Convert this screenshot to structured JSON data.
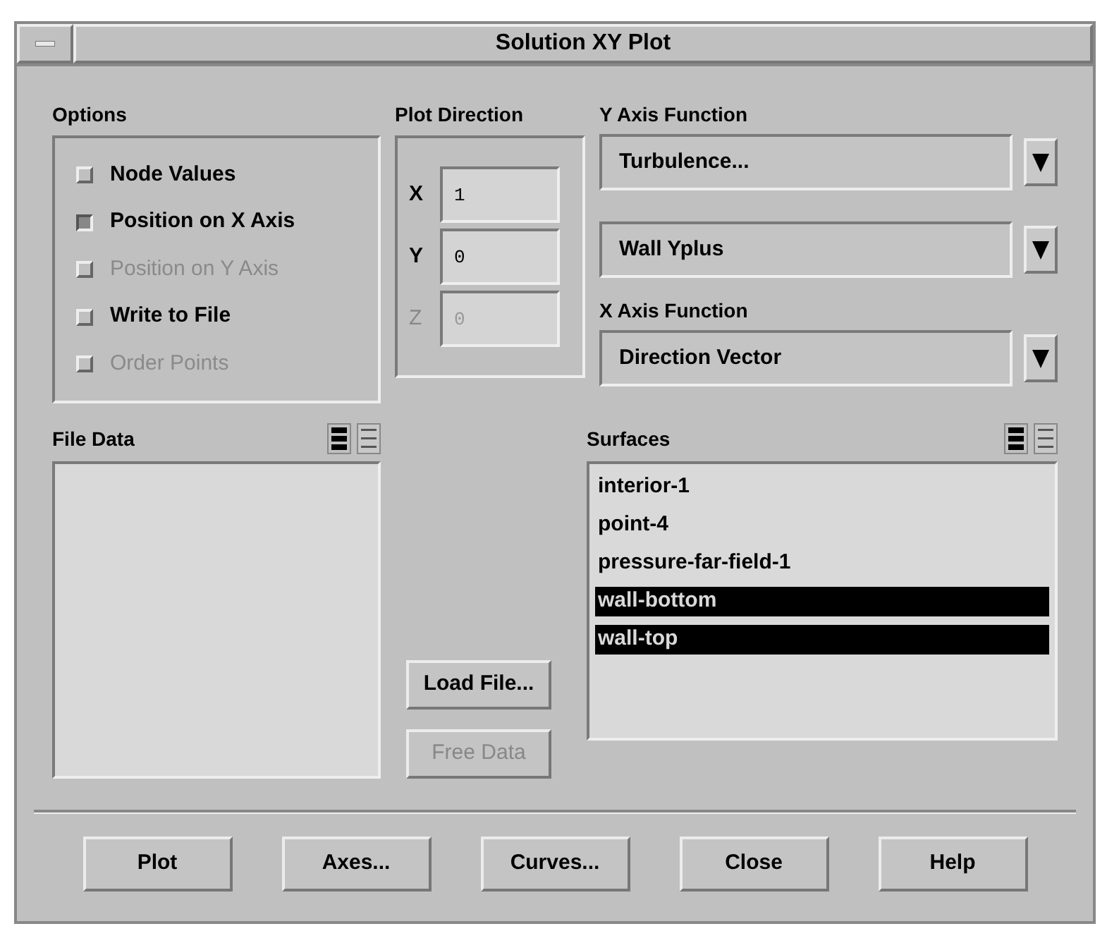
{
  "window": {
    "title": "Solution XY Plot"
  },
  "options": {
    "label": "Options",
    "items": [
      {
        "label": "Node Values",
        "checked": false,
        "disabled": false
      },
      {
        "label": "Position on X Axis",
        "checked": true,
        "disabled": false
      },
      {
        "label": "Position on Y Axis",
        "checked": false,
        "disabled": true
      },
      {
        "label": "Write to File",
        "checked": false,
        "disabled": false
      },
      {
        "label": "Order Points",
        "checked": false,
        "disabled": true
      }
    ]
  },
  "plot_direction": {
    "label": "Plot Direction",
    "fields": [
      {
        "label": "X",
        "value": "1",
        "disabled": false
      },
      {
        "label": "Y",
        "value": "0",
        "disabled": false
      },
      {
        "label": "Z",
        "value": "0",
        "disabled": true
      }
    ]
  },
  "y_axis_function": {
    "label": "Y Axis Function",
    "dropdowns": [
      {
        "value": "Turbulence..."
      },
      {
        "value": "Wall Yplus"
      }
    ]
  },
  "x_axis_function": {
    "label": "X Axis Function",
    "dropdowns": [
      {
        "value": "Direction Vector"
      }
    ]
  },
  "file_data": {
    "label": "File Data"
  },
  "file_buttons": [
    {
      "label": "Load File...",
      "disabled": false
    },
    {
      "label": "Free Data",
      "disabled": true
    }
  ],
  "surfaces": {
    "label": "Surfaces",
    "items": [
      {
        "label": "interior-1",
        "selected": false
      },
      {
        "label": "point-4",
        "selected": false
      },
      {
        "label": "pressure-far-field-1",
        "selected": false
      },
      {
        "label": "wall-bottom",
        "selected": true
      },
      {
        "label": "wall-top",
        "selected": true
      }
    ]
  },
  "buttons": [
    {
      "label": "Plot"
    },
    {
      "label": "Axes..."
    },
    {
      "label": "Curves..."
    },
    {
      "label": "Close"
    },
    {
      "label": "Help"
    }
  ]
}
